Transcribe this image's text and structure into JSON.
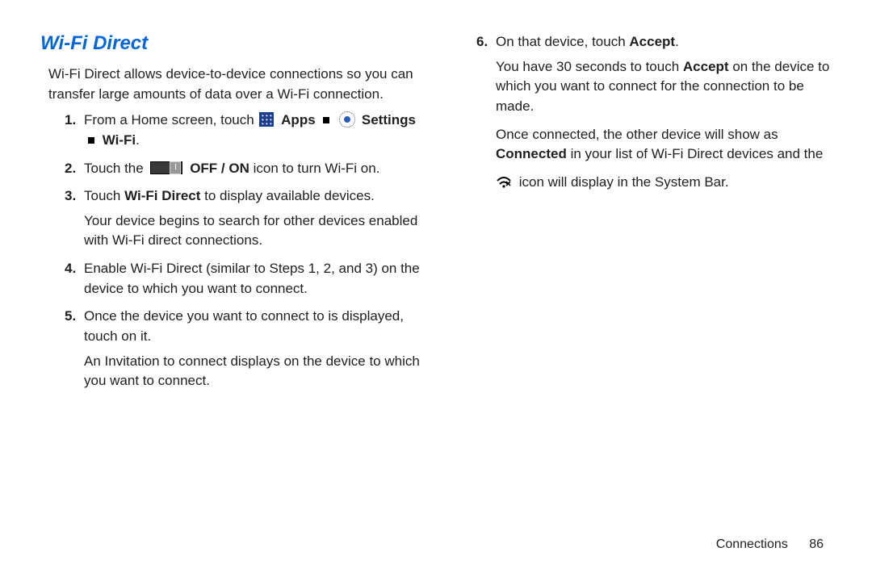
{
  "title": "Wi-Fi Direct",
  "intro": "Wi-Fi Direct allows device-to-device connections so you can transfer large amounts of data over a Wi-Fi connection.",
  "steps": {
    "s1": {
      "num": "1.",
      "pre": "From a Home screen, touch ",
      "apps": "Apps",
      "settings": "Settings",
      "wifi": "Wi-Fi",
      "end": "."
    },
    "s2": {
      "num": "2.",
      "pre": "Touch the ",
      "offon": "OFF / ON",
      "post": " icon to turn Wi-Fi on."
    },
    "s3": {
      "num": "3.",
      "pre": "Touch ",
      "wfd": "Wi-Fi Direct",
      "post": " to display available devices.",
      "cont": "Your device begins to search for other devices enabled with Wi-Fi direct connections."
    },
    "s4": {
      "num": "4.",
      "text": "Enable Wi-Fi Direct (similar to Steps 1, 2, and 3) on the device to which you want to connect."
    },
    "s5": {
      "num": "5.",
      "text": "Once the device you want to connect to is displayed, touch on it.",
      "cont": "An Invitation to connect displays on the device to which you want to connect."
    },
    "s6": {
      "num": "6.",
      "pre": "On that device, touch ",
      "accept": "Accept",
      "end": ".",
      "cont_pre": "You have 30 seconds to touch ",
      "cont_accept": "Accept",
      "cont_post": " on the device to which you want to connect for the connection to be made."
    }
  },
  "result": {
    "line1_pre": "Once connected, the other device will show as ",
    "connected": "Connected",
    "line1_post": " in your list of Wi-Fi Direct devices and the",
    "line2": "icon will display in the System Bar."
  },
  "footer": {
    "section": "Connections",
    "page": "86"
  }
}
